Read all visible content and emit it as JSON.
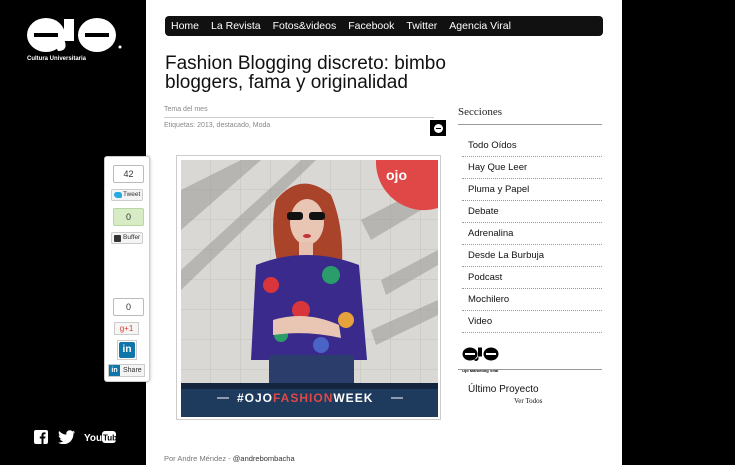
{
  "brand": {
    "logo_text": "OJO",
    "tagline": "Cultura Universitaria",
    "mini_logo_tag": "Ojo Marketing Viral"
  },
  "social": {
    "facebook_glyph": "f",
    "youtube_label": "YouTube"
  },
  "nav": {
    "items": [
      "Home",
      "La Revista",
      "Fotos&videos",
      "Facebook",
      "Twitter",
      "Agencia Viral"
    ]
  },
  "article": {
    "title": "Fashion Blogging discreto: bimbo bloggers, fama y originalidad",
    "category": "Tema del mes",
    "tags_label": "Etiquetas:",
    "tags": "2013, destacado, Moda",
    "image_banner_prefix": "#OJO",
    "image_banner_highlight": "FASHION",
    "image_banner_suffix": "WEEK",
    "author_prefix": "Por Andre Méndez -",
    "author_handle": "@andrebombacha"
  },
  "sidebar": {
    "title": "Secciones",
    "items": [
      "Todo Oídos",
      "Hay Que Leer",
      "Pluma y Papel",
      "Debate",
      "Adrenalina",
      "Desde La Burbuja",
      "Podcast",
      "Mochilero",
      "Video"
    ],
    "project_title": "Último Proyecto",
    "see_all": "Ver Todos"
  },
  "share": {
    "tweet_count": "42",
    "tweet_label": "Tweet",
    "buffer_count": "0",
    "buffer_label": "Buffer",
    "gplus_count": "0",
    "gplus_label": "g+1",
    "linkedin_glyph": "in",
    "linkedin_share": "Share"
  },
  "colors": {
    "accent_red": "#e04848",
    "banner_navy": "#1e3a5c",
    "linkedin_blue": "#0e76a8"
  }
}
